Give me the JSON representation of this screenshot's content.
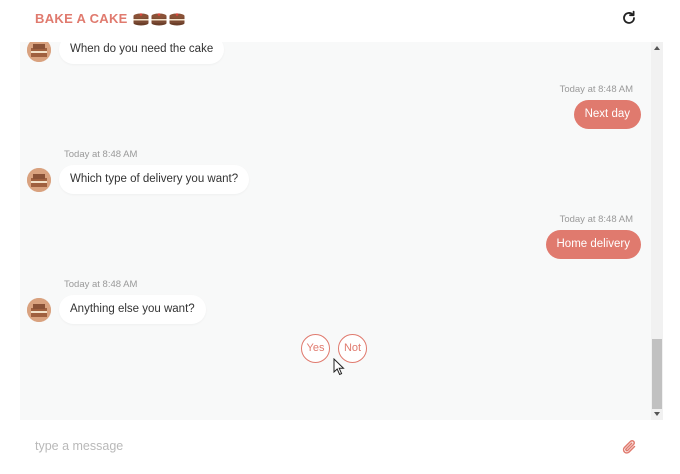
{
  "header": {
    "title": "BAKE A CAKE",
    "title_color": "#e07a6e",
    "cake_icons": [
      "cake-icon",
      "cake-icon",
      "cake-icon"
    ],
    "refresh_icon": "refresh-icon"
  },
  "messages": [
    {
      "direction": "in",
      "text": "When do you need the cake"
    },
    {
      "direction": "out",
      "timestamp": "Today at 8:48 AM",
      "text": "Next day"
    },
    {
      "direction": "in",
      "timestamp": "Today at 8:48 AM",
      "text": "Which type of delivery you want?"
    },
    {
      "direction": "out",
      "timestamp": "Today at 8:48 AM",
      "text": "Home delivery"
    },
    {
      "direction": "in",
      "timestamp": "Today at 8:48 AM",
      "text": "Anything else you want?"
    }
  ],
  "quick_replies": [
    {
      "label": "Yes"
    },
    {
      "label": "Not"
    }
  ],
  "composer": {
    "placeholder": "type a message",
    "value": "",
    "attach_icon": "paperclip-icon"
  },
  "colors": {
    "accent": "#e07a6e",
    "chat_bg": "#f8f9f9",
    "timestamp": "#9a9a9a"
  }
}
